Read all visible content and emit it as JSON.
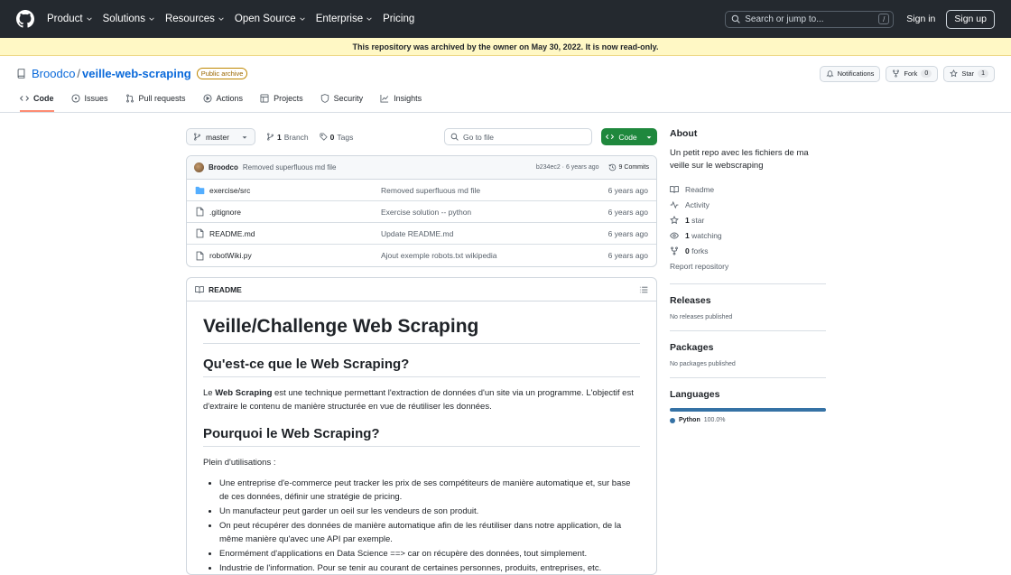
{
  "header": {
    "nav": [
      "Product",
      "Solutions",
      "Resources",
      "Open Source",
      "Enterprise",
      "Pricing"
    ],
    "search_placeholder": "Search or jump to...",
    "search_key": "/",
    "sign_in": "Sign in",
    "sign_up": "Sign up"
  },
  "banner": "This repository was archived by the owner on May 30, 2022. It is now read-only.",
  "repo": {
    "owner": "Broodco",
    "separator": "/",
    "name": "veille-web-scraping",
    "visibility": "Public archive",
    "notifications": "Notifications",
    "fork_label": "Fork",
    "fork_count": "0",
    "star_label": "Star",
    "star_count": "1"
  },
  "tabs": [
    {
      "label": "Code",
      "active": true
    },
    {
      "label": "Issues"
    },
    {
      "label": "Pull requests"
    },
    {
      "label": "Actions"
    },
    {
      "label": "Projects"
    },
    {
      "label": "Security"
    },
    {
      "label": "Insights"
    }
  ],
  "toolbar": {
    "branch": "master",
    "branch_count": "1",
    "branch_label": "Branch",
    "tag_count": "0",
    "tag_label": "Tags",
    "goto_placeholder": "Go to file",
    "code_label": "Code"
  },
  "commit": {
    "author": "Broodco",
    "message": "Removed superfluous md file",
    "hash_age": "b234ec2 · 6 years ago",
    "commits": "9 Commits"
  },
  "files": [
    {
      "name": "exercise/src",
      "type": "folder",
      "message": "Removed superfluous md file",
      "age": "6 years ago"
    },
    {
      "name": ".gitignore",
      "type": "file",
      "message": "Exercise solution -- python",
      "age": "6 years ago"
    },
    {
      "name": "README.md",
      "type": "file",
      "message": "Update README.md",
      "age": "6 years ago"
    },
    {
      "name": "robotWiki.py",
      "type": "file",
      "message": "Ajout exemple robots.txt wikipedia",
      "age": "6 years ago"
    }
  ],
  "readme": {
    "tab_label": "README",
    "h1": "Veille/Challenge Web Scraping",
    "h2_what": "Qu'est-ce que le Web Scraping?",
    "p1_pre": "Le ",
    "p1_bold": "Web Scraping",
    "p1_post": " est une technique permettant l'extraction de données d'un site via un programme. L'objectif est d'extraire le contenu de manière structurée en vue de réutiliser les données.",
    "h2_why": "Pourquoi le Web Scraping?",
    "p2": "Plein d'utilisations :",
    "items": [
      "Une entreprise d'e-commerce peut tracker les prix de ses compétiteurs de manière automatique et, sur base de ces données, définir une stratégie de pricing.",
      "Un manufacteur peut garder un oeil sur les vendeurs de son produit.",
      "On peut récupérer des données de manière automatique afin de les réutiliser dans notre application, de la même manière qu'avec une API par exemple.",
      "Enormément d'applications en Data Science ==> car on récupère des données, tout simplement.",
      "Industrie de l'information. Pour se tenir au courant de certaines personnes, produits, entreprises, etc."
    ]
  },
  "about": {
    "title": "About",
    "description": "Un petit repo avec les fichiers de ma veille sur le webscraping",
    "readme": "Readme",
    "activity": "Activity",
    "stars_count": "1",
    "stars_label": "star",
    "watching_count": "1",
    "watching_label": "watching",
    "forks_count": "0",
    "forks_label": "forks",
    "report": "Report repository"
  },
  "releases": {
    "title": "Releases",
    "empty": "No releases published"
  },
  "packages": {
    "title": "Packages",
    "empty": "No packages published"
  },
  "languages": {
    "title": "Languages",
    "items": [
      {
        "name": "Python",
        "pct": "100.0%",
        "color": "#3572a5"
      }
    ]
  },
  "colors": {
    "header_bg": "#24292f",
    "accent": "#0969da",
    "code_btn": "#1f883d",
    "tab_underline": "#fd8c73",
    "banner_bg": "#fff8c5"
  }
}
